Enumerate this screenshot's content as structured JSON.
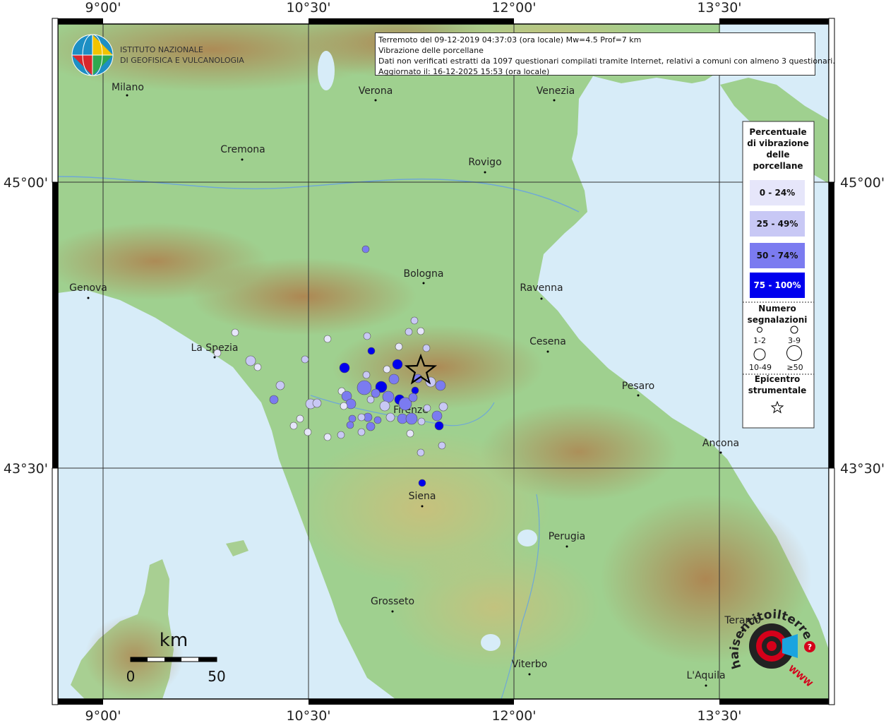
{
  "header": {
    "institute_logo_text": [
      "ISTITUTO NAZIONALE",
      "DI GEOFISICA E VULCANOLOGIA"
    ],
    "info_lines": [
      "Terremoto del 09-12-2019 04:37:03 (ora locale) Mw=4.5 Prof=7 km",
      "Vibrazione delle porcellane",
      "Dati non verificati estratti da 1097 questionari compilati tramite Internet, relativi a comuni con almeno 3 questionari.",
      "Aggiornato il: 16-12-2025 15:53 (ora locale)"
    ]
  },
  "axes": {
    "lon_labels": [
      "9°00'",
      "10°30'",
      "12°00'",
      "13°30'"
    ],
    "lat_labels": [
      "45°00'",
      "43°30'"
    ]
  },
  "cities": [
    {
      "name": "Milano"
    },
    {
      "name": "Verona"
    },
    {
      "name": "Venezia"
    },
    {
      "name": "Cremona"
    },
    {
      "name": "Rovigo"
    },
    {
      "name": "Bologna"
    },
    {
      "name": "Genova"
    },
    {
      "name": "Ravenna"
    },
    {
      "name": "La Spezia"
    },
    {
      "name": "Cesena"
    },
    {
      "name": "Pesaro"
    },
    {
      "name": "Firenze"
    },
    {
      "name": "Ancona"
    },
    {
      "name": "Siena"
    },
    {
      "name": "Perugia"
    },
    {
      "name": "Grosseto"
    },
    {
      "name": "Teramo"
    },
    {
      "name": "Viterbo"
    },
    {
      "name": "L'Aquila"
    }
  ],
  "scale_bar": {
    "unit": "km",
    "start": "0",
    "end": "50"
  },
  "legend": {
    "percent_title": [
      "Percentuale",
      "di vibrazione",
      "delle",
      "porcellane"
    ],
    "classes": [
      {
        "label": "0 - 24%",
        "color": "#e6e6fa"
      },
      {
        "label": "25 - 49%",
        "color": "#c8c8f5"
      },
      {
        "label": "50 - 74%",
        "color": "#7b7bf0"
      },
      {
        "label": "75 - 100%",
        "color": "#0000ee"
      }
    ],
    "count_title": [
      "Numero",
      "segnalazioni"
    ],
    "count_sizes": [
      "1-2",
      "3-9",
      "10-49",
      "≥50"
    ],
    "epicenter_title": [
      "Epicentro",
      "strumentale"
    ]
  },
  "brand": {
    "arc_text": "haisentitoilterremoto.it",
    "www_text": "WWW",
    "accent_color": "#d4001a",
    "icon": "speaker-target-icon"
  },
  "colors": {
    "sea": "#d7ecf8",
    "plain": "#9ccf8e",
    "hills": "#c7c07f",
    "mountains": "#b98b58",
    "epicenter": "#000000"
  }
}
